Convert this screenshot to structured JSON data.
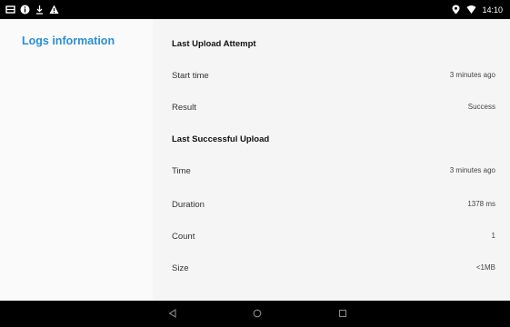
{
  "status_bar": {
    "time": "14:10",
    "left_icons": [
      "notification-icon",
      "info-icon",
      "download-icon",
      "warning-icon"
    ],
    "right_icons": [
      "location-icon",
      "wifi-icon"
    ]
  },
  "sidebar": {
    "title": "Logs information",
    "accent_color": "#2a8fd1"
  },
  "main": {
    "sections": [
      {
        "heading": "Last Upload Attempt",
        "rows": [
          {
            "label": "Start time",
            "value": "3 minutes ago"
          },
          {
            "label": "Result",
            "value": "Success"
          }
        ]
      },
      {
        "heading": "Last Successful Upload",
        "rows": [
          {
            "label": "Time",
            "value": "3 minutes ago"
          },
          {
            "label": "Duration",
            "value": "1378 ms"
          },
          {
            "label": "Count",
            "value": "1"
          },
          {
            "label": "Size",
            "value": "<1MB"
          }
        ]
      }
    ]
  },
  "nav_bar": {
    "buttons": [
      "back-icon",
      "home-icon",
      "recents-icon"
    ]
  }
}
